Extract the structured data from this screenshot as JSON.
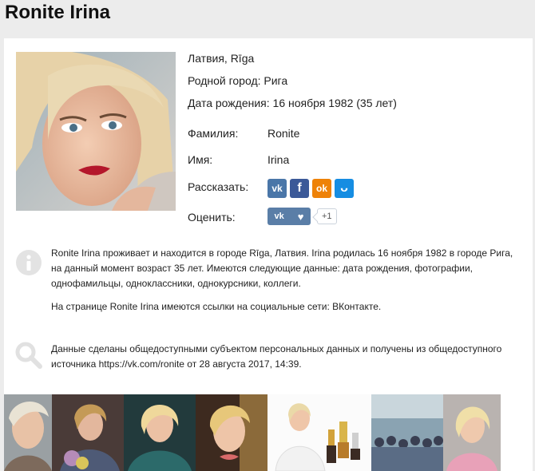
{
  "title": "Ronite Irina",
  "location": "Латвия, Rīga",
  "hometown": "Родной город: Рига",
  "birth": "Дата рождения: 16 ноября 1982 (35 лет)",
  "fields": [
    {
      "label": "Фамилия:",
      "value": "Ronite"
    },
    {
      "label": "Имя:",
      "value": "Irina"
    }
  ],
  "share_label": "Рассказать:",
  "share_buttons": [
    {
      "name": "vk",
      "glyph": "vk",
      "color": "#4a76a8"
    },
    {
      "name": "facebook",
      "glyph": "f",
      "color": "#3b5998"
    },
    {
      "name": "odnoklassniki",
      "glyph": "ok",
      "color": "#ee8208"
    },
    {
      "name": "moimir",
      "glyph": "ᴗ",
      "color": "#168de2"
    }
  ],
  "rate_label": "Оценить:",
  "rate_count": "+1",
  "description": [
    "Ronite Irina проживает и находится в городе Rīga, Латвия. Irina родилась 16 ноября 1982 в городе Рига, на данный момент возраст 35 лет. Имеются следующие данные: дата рождения, фотографии, однофамильцы, одноклассники, однокурсники, коллеги.",
    "На странице Ronite Irina имеются ссылки на социальные сети: ВКонтакте."
  ],
  "source_text": "Данные сделаны общедоступными субъектом персональных данных и получены из общедоступного источника https://vk.com/ronite от 28 августа 2017, 14:39."
}
